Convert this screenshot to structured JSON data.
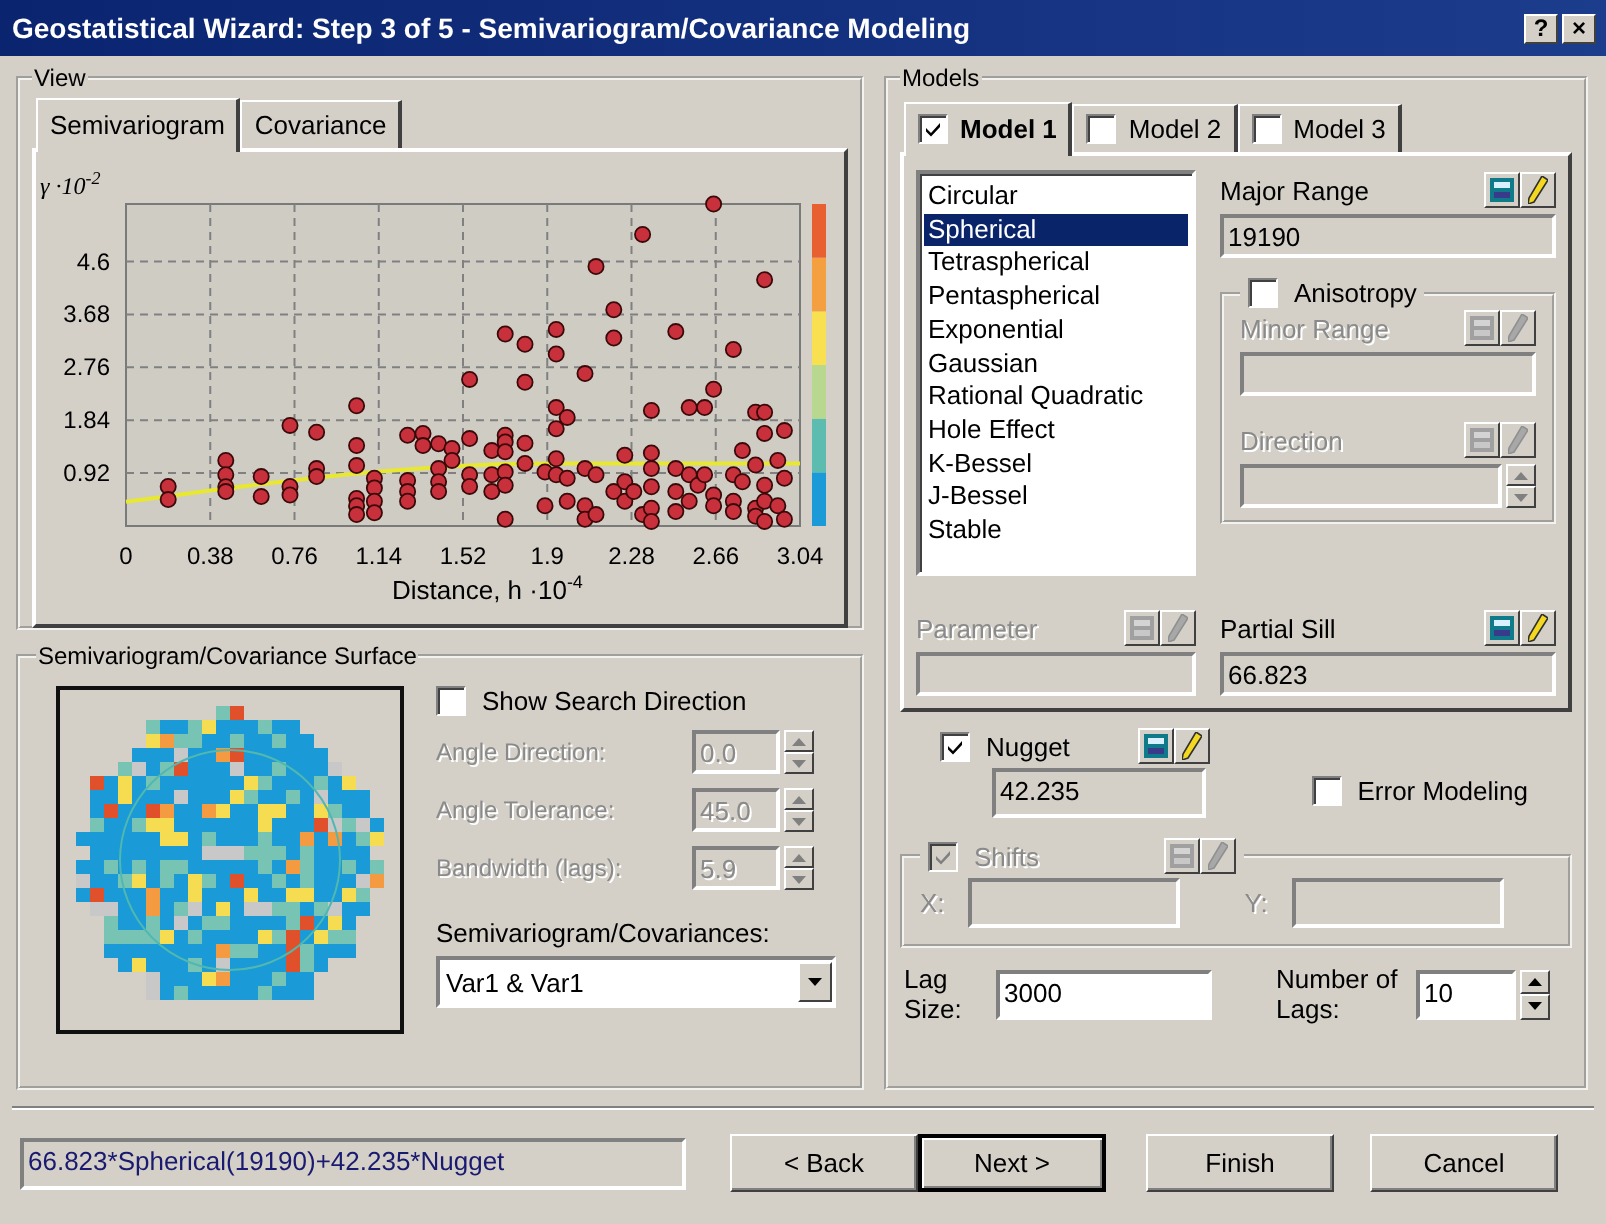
{
  "window": {
    "title": "Geostatistical Wizard: Step 3 of 5 - Semivariogram/Covariance Modeling",
    "buttons": [
      "?",
      "×"
    ]
  },
  "view": {
    "label": "View",
    "tabs": [
      {
        "label": "Semivariogram",
        "selected": true
      },
      {
        "label": "Covariance",
        "selected": false
      }
    ],
    "chart_data": {
      "type": "scatter",
      "xlabel": "Distance, h ·10$^{-4}$",
      "ylabel": "γ ·10$^{-2}$",
      "x": [
        0.19,
        0.19,
        0.45,
        0.45,
        0.45,
        0.45,
        0.61,
        0.61,
        0.74,
        0.74,
        0.74,
        0.86,
        0.86,
        0.86,
        1.04,
        1.04,
        1.04,
        1.04,
        1.04,
        1.04,
        1.12,
        1.12,
        1.12,
        1.12,
        1.27,
        1.27,
        1.27,
        1.27,
        1.34,
        1.34,
        1.41,
        1.41,
        1.41,
        1.41,
        1.47,
        1.47,
        1.55,
        1.55,
        1.55,
        1.55,
        1.65,
        1.65,
        1.65,
        1.71,
        1.71,
        1.71,
        1.71,
        1.71,
        1.71,
        1.71,
        1.8,
        1.8,
        1.8,
        1.8,
        1.89,
        1.89,
        1.94,
        1.94,
        1.94,
        1.94,
        1.94,
        1.94,
        1.99,
        1.99,
        1.99,
        2.07,
        2.07,
        2.07,
        2.07,
        2.12,
        2.12,
        2.12,
        2.2,
        2.2,
        2.2,
        2.25,
        2.25,
        2.25,
        2.29,
        2.33,
        2.33,
        2.37,
        2.37,
        2.37,
        2.37,
        2.37,
        2.37,
        2.48,
        2.48,
        2.48,
        2.48,
        2.54,
        2.54,
        2.54,
        2.58,
        2.61,
        2.61,
        2.65,
        2.65,
        2.65,
        2.65,
        2.74,
        2.74,
        2.74,
        2.74,
        2.78,
        2.78,
        2.84,
        2.84,
        2.84,
        2.84,
        2.88,
        2.88,
        2.88,
        2.88,
        2.88,
        2.88,
        2.94,
        2.94,
        2.97,
        2.97,
        2.97
      ],
      "xlim": [
        0,
        3.04
      ],
      "ylim": [
        0,
        5.6
      ],
      "grid": true,
      "xticks": [
        0,
        0.38,
        0.76,
        1.14,
        1.52,
        1.9,
        2.28,
        2.66,
        3.04
      ],
      "yticks": [
        0.92,
        1.84,
        2.76,
        3.68,
        4.6
      ],
      "series": [
        {
          "color": "#c8303c",
          "values": [
            0.69,
            0.46,
            1.14,
            0.89,
            0.68,
            0.6,
            0.86,
            0.51,
            1.75,
            0.69,
            0.54,
            1.63,
            1.0,
            0.86,
            2.09,
            1.4,
            1.05,
            0.48,
            0.35,
            0.2,
            0.83,
            0.66,
            0.43,
            0.23,
            1.58,
            0.79,
            0.6,
            0.43,
            1.61,
            1.4,
            1.43,
            1.0,
            0.77,
            0.6,
            1.35,
            1.14,
            2.55,
            1.52,
            0.89,
            0.69,
            1.31,
            0.89,
            0.6,
            3.34,
            1.58,
            1.46,
            1.29,
            0.94,
            0.71,
            0.12,
            3.16,
            2.5,
            1.44,
            1.09,
            0.94,
            0.35,
            3.42,
            2.99,
            2.06,
            1.69,
            1.17,
            0.89,
            1.89,
            0.83,
            0.43,
            2.65,
            1.0,
            0.35,
            0.12,
            4.51,
            0.89,
            0.2,
            3.76,
            3.27,
            0.6,
            1.23,
            0.77,
            0.43,
            0.6,
            5.07,
            0.2,
            2.01,
            1.27,
            1.0,
            0.68,
            0.31,
            0.08,
            3.38,
            1.0,
            0.6,
            0.25,
            2.06,
            0.89,
            0.43,
            0.71,
            2.06,
            0.89,
            5.6,
            2.38,
            0.54,
            0.35,
            3.07,
            0.89,
            0.43,
            0.25,
            1.31,
            0.77,
            1.98,
            1.06,
            0.31,
            0.17,
            4.28,
            1.98,
            1.61,
            0.71,
            0.43,
            0.08,
            1.14,
            0.35,
            1.66,
            0.83,
            0.12
          ]
        },
        {
          "type": "line",
          "color": "#e8e830",
          "x": [
            0,
            0.19,
            0.38,
            0.57,
            0.76,
            0.95,
            1.14,
            1.33,
            1.52,
            1.71,
            1.919,
            3.04
          ],
          "values": [
            0.42,
            0.519,
            0.616,
            0.709,
            0.796,
            0.876,
            0.945,
            1.003,
            1.048,
            1.077,
            1.088,
            1.088
          ]
        }
      ]
    }
  },
  "surface": {
    "label": "Semivariogram/Covariance Surface",
    "show_search_direction": {
      "label": "Show Search Direction",
      "checked": false
    },
    "fields": [
      {
        "label": "Angle Direction:",
        "value": "0.0",
        "disabled": true
      },
      {
        "label": "Angle Tolerance:",
        "value": "45.0",
        "disabled": true
      },
      {
        "label": "Bandwidth (lags):",
        "value": "5.9",
        "disabled": true
      }
    ],
    "covariances": {
      "label": "Semivariogram/Covariances:",
      "value": "Var1 & Var1"
    }
  },
  "models": {
    "label": "Models",
    "tabs": [
      {
        "label": "Model 1",
        "checked": true,
        "selected": true
      },
      {
        "label": "Model 2",
        "checked": false,
        "selected": false
      },
      {
        "label": "Model 3",
        "checked": false,
        "selected": false
      }
    ],
    "types": [
      {
        "label": "Circular",
        "selected": false
      },
      {
        "label": "Spherical",
        "selected": true
      },
      {
        "label": "Tetraspherical",
        "selected": false
      },
      {
        "label": "Pentaspherical",
        "selected": false
      },
      {
        "label": "Exponential",
        "selected": false
      },
      {
        "label": "Gaussian",
        "selected": false
      },
      {
        "label": "Rational Quadratic",
        "selected": false
      },
      {
        "label": "Hole Effect",
        "selected": false
      },
      {
        "label": "K-Bessel",
        "selected": false
      },
      {
        "label": "J-Bessel",
        "selected": false
      },
      {
        "label": "Stable",
        "selected": false
      }
    ],
    "major_range": {
      "label": "Major Range",
      "value": "19190",
      "disabled": false
    },
    "anisotropy": {
      "label": "Anisotropy",
      "checked": false
    },
    "minor_range": {
      "label": "Minor Range",
      "disabled": true
    },
    "direction": {
      "label": "Direction",
      "disabled": true
    },
    "parameter": {
      "label": "Parameter",
      "disabled": true
    },
    "partial_sill": {
      "label": "Partial Sill",
      "value": "66.823",
      "disabled": false
    },
    "nugget": {
      "label": "Nugget",
      "checked": true,
      "value": "42.235"
    },
    "error_modeling": {
      "label": "Error Modeling",
      "checked": false
    },
    "shifts": {
      "label": "Shifts",
      "checked": true,
      "disabled": true,
      "x_label": "X:",
      "y_label": "Y:"
    },
    "lag_size": {
      "label": "Lag Size:",
      "value": "3000"
    },
    "number_of_lags": {
      "label": "Number of Lags:",
      "value": "10"
    }
  },
  "formula": "66.823*Spherical(19190)+42.235*Nugget",
  "buttons": [
    {
      "label": "< Back",
      "default": false
    },
    {
      "label": "Next >",
      "default": true
    },
    {
      "label": "Finish",
      "default": false
    },
    {
      "label": "Cancel",
      "default": false
    }
  ]
}
